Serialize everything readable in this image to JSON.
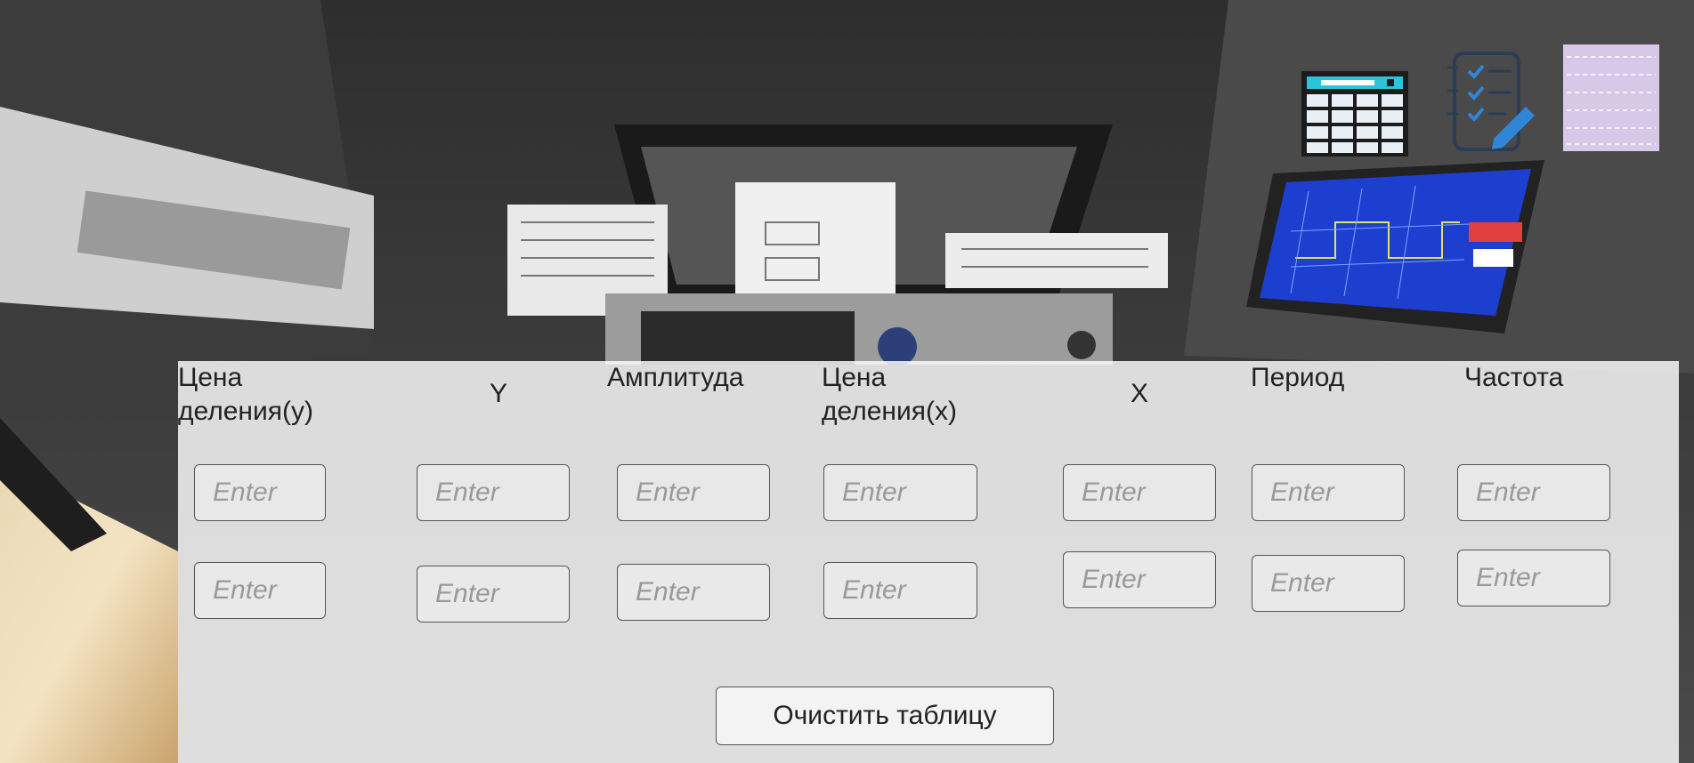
{
  "table": {
    "headers": [
      "Цена деления(y)",
      "Y",
      "Амплитуда",
      "Цена деления(x)",
      "X",
      "Период",
      "Частота"
    ],
    "placeholder": "Enter",
    "rows": 2
  },
  "clear_button_label": "Очистить таблицу",
  "toolbar_icons": [
    "table-icon",
    "checklist-icon",
    "notes-icon"
  ],
  "colors": {
    "panel": "#ffffff",
    "screen_blue": "#1d3fd0",
    "notes_lilac": "#d8c8e8"
  }
}
